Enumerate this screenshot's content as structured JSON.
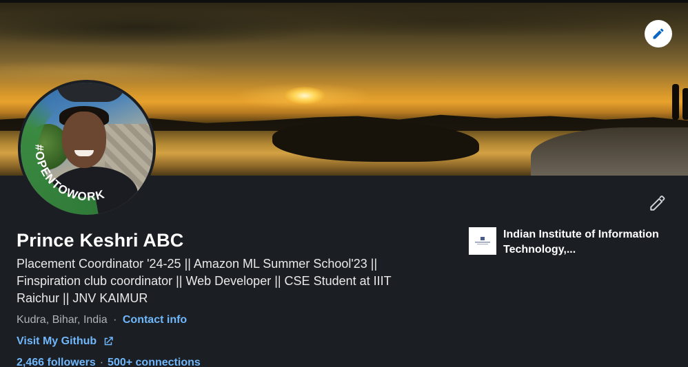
{
  "profile": {
    "name": "Prince Keshri ABC",
    "headline": "Placement Coordinator '24-25 || Amazon ML Summer School'23 || Finspiration club coordinator || Web Developer || CSE Student at IIIT Raichur || JNV KAIMUR",
    "location": "Kudra, Bihar, India",
    "separator": "·",
    "contact_info_label": "Contact info",
    "website_label": "Visit My Github",
    "followers": "2,466 followers",
    "connections": "500+ connections",
    "stats_separator": "·",
    "open_to_work_badge": "#OPENTOWORK"
  },
  "education": {
    "school_name": "Indian Institute of Information Technology,..."
  },
  "icons": {
    "cover_edit": "pencil-icon",
    "profile_edit": "pencil-icon",
    "external_link": "external-link-icon"
  },
  "colors": {
    "background": "#1b1f23",
    "link": "#71b7fb",
    "open_to_work_ring": "#3b8a41",
    "edit_icon_blue": "#0a66c2"
  }
}
